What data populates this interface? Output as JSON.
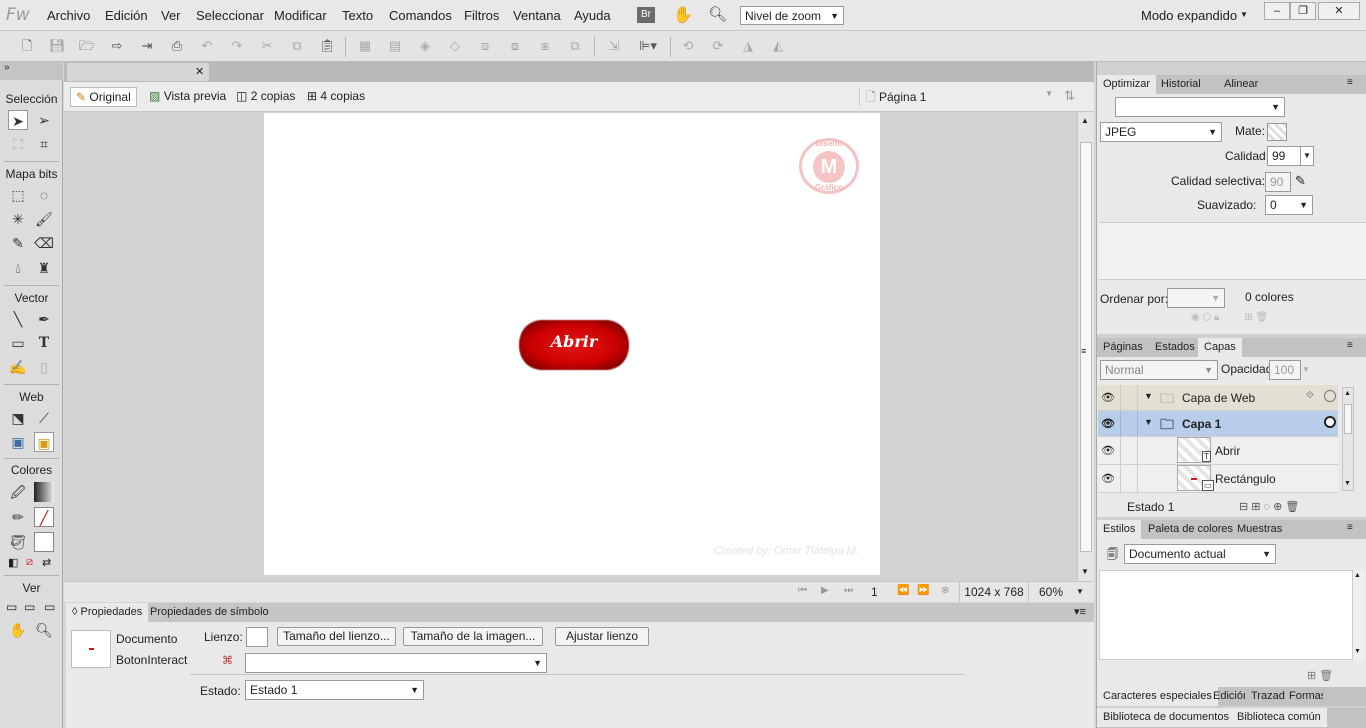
{
  "app": {
    "logo": "Fw"
  },
  "menu": [
    "Archivo",
    "Edición",
    "Ver",
    "Seleccionar",
    "Modificar",
    "Texto",
    "Comandos",
    "Filtros",
    "Ventana",
    "Ayuda"
  ],
  "menu_extra": {
    "br": "Br",
    "zoom_select": "Nivel de zoom",
    "workspace": "Modo expandido"
  },
  "tools": {
    "seleccion": "Selección",
    "mapa_bits": "Mapa bits",
    "vector": "Vector",
    "web": "Web",
    "colores": "Colores",
    "ver": "Ver"
  },
  "document": {
    "views": [
      "Original",
      "Vista previa",
      "2 copias",
      "4 copias"
    ],
    "page_select": "Página 1",
    "canvas": {
      "button_text": "Abrir",
      "watermark_top": "Diseño",
      "watermark_bottom": "Gráfico",
      "credit": "Created by: Omar Tlatelpa M."
    },
    "status": {
      "frame": "1",
      "size": "1024 x 768",
      "zoom": "60%"
    }
  },
  "properties": {
    "tabs": [
      "Propiedades",
      "Propiedades de símbolo"
    ],
    "doc_type": "Documento",
    "doc_name": "BotonInteracti",
    "lienzo_label": "Lienzo:",
    "btn_canvas_size": "Tamaño del lienzo...",
    "btn_image_size": "Tamaño de la imagen...",
    "btn_fit": "Ajustar lienzo",
    "estado_label": "Estado:",
    "estado_value": "Estado 1"
  },
  "optimize": {
    "tabs": [
      "Optimizar",
      "Historial",
      "Alinear"
    ],
    "format": "JPEG",
    "mate_label": "Mate:",
    "calidad_label": "Calidad:",
    "calidad_value": "99",
    "calidad_sel_label": "Calidad selectiva:",
    "calidad_sel_value": "90",
    "suavizado_label": "Suavizado:",
    "suavizado_value": "0",
    "ordenar_label": "Ordenar por:",
    "colores": "0 colores"
  },
  "layers": {
    "tabs": [
      "Páginas",
      "Estados",
      "Capas"
    ],
    "blend": "Normal",
    "opacity_label": "Opacidad",
    "opacity_value": "100",
    "rows": [
      {
        "name": "Capa de Web"
      },
      {
        "name": "Capa 1"
      },
      {
        "name": "Abrir"
      },
      {
        "name": "Rectángulo"
      }
    ],
    "state": "Estado 1"
  },
  "styles": {
    "tabs": [
      "Estilos",
      "Paleta de colores",
      "Muestras"
    ],
    "select": "Documento actual"
  },
  "bottom_tabs": {
    "row1": [
      "Caracteres especiales",
      "Edición",
      "Trazad",
      "Formas"
    ],
    "row2": [
      "Biblioteca de documentos",
      "Biblioteca común"
    ]
  },
  "colors": {
    "accent_red": "#d4141a",
    "layer_selected": "#b7cdea"
  }
}
